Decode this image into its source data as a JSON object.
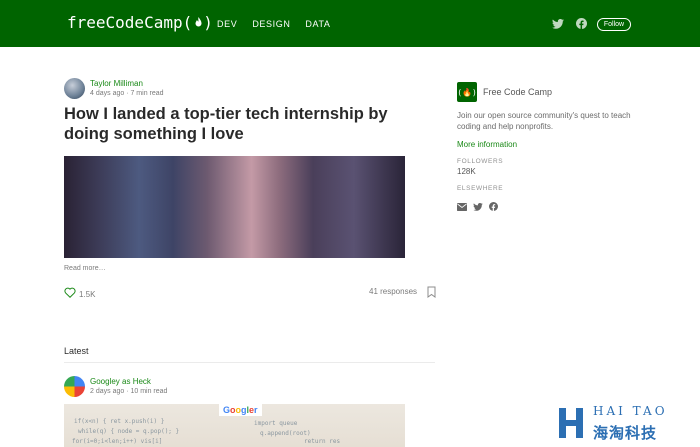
{
  "header": {
    "brand": "freeCodeCamp(",
    "brand_tail": ")",
    "nav": [
      "DEV",
      "DESIGN",
      "DATA"
    ],
    "follow_label": "Follow",
    "background": "#006400"
  },
  "featured": {
    "author": "Taylor Milliman",
    "meta": "4 days ago · 7 min read",
    "title": "How I landed a top-tier tech internship by doing something I love",
    "read_more": "Read more…",
    "claps": "1.5K",
    "responses": "41 responses"
  },
  "latest": {
    "heading": "Latest",
    "author": "Googley as Heck",
    "meta": "2 days ago · 10 min read"
  },
  "sidebar": {
    "publication": "Free Code Camp",
    "description": "Join our open source community's quest to teach coding and help nonprofits.",
    "more_info": "More information",
    "followers_label": "FOLLOWERS",
    "followers_value": "128K",
    "elsewhere_label": "ELSEWHERE"
  },
  "watermark": {
    "line1": "HAI TAO",
    "line2": "海淘科技"
  },
  "icons": {
    "twitter": "twitter-icon",
    "facebook": "facebook-icon",
    "heart": "heart-icon",
    "bookmark": "bookmark-icon",
    "mail": "mail-icon"
  },
  "colors": {
    "accent_green": "#1a8917",
    "brand_green": "#006400"
  }
}
